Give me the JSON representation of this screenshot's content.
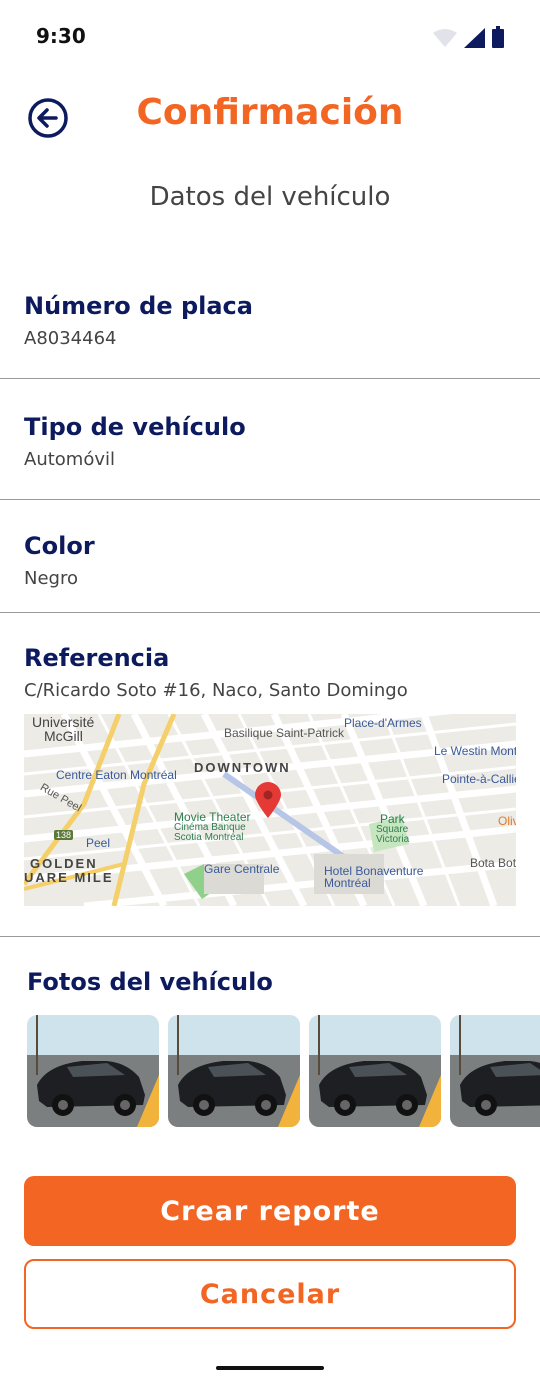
{
  "status": {
    "time": "9:30"
  },
  "header": {
    "title": "Confirmación",
    "back_icon": "arrow-left-circle-icon"
  },
  "subtitle": "Datos del vehículo",
  "fields": [
    {
      "label": "Número de placa",
      "value": "A8034464"
    },
    {
      "label": "Tipo de vehículo",
      "value": "Automóvil"
    },
    {
      "label": "Color",
      "value": "Negro"
    },
    {
      "label": "Referencia",
      "value": "C/Ricardo Soto #16, Naco, Santo Domingo"
    }
  ],
  "map": {
    "labels": {
      "universite": "Université",
      "mcgill": "McGill",
      "basilique": "Basilique Saint-Patrick",
      "place_darmes": "Place-d'Armes",
      "centre_eaton": "Centre Eaton Montréal",
      "downtown": "DOWNTOWN",
      "westin": "Le Westin Mont",
      "pointe": "Pointe-à-Calliè",
      "movie1": "Movie Theater",
      "movie2": "Cinéma Banque",
      "movie3": "Scotia Montréal",
      "park1": "Park",
      "park2": "Square",
      "park3": "Victoria",
      "peel": "Peel",
      "golden": "GOLDEN",
      "square_mile": "UARE MILE",
      "gare": "Gare Centrale",
      "hotel1": "Hotel Bonaventure",
      "hotel2": "Montréal",
      "bota": "Bota Bota",
      "olive": "Oliv",
      "rue_peel": "Rue Peel",
      "route": "138"
    },
    "pin_icon": "map-pin-icon"
  },
  "photos": {
    "title": "Fotos del vehículo",
    "items": [
      "car-photo",
      "car-photo",
      "car-photo",
      "car-photo"
    ]
  },
  "actions": {
    "primary": "Crear reporte",
    "secondary": "Cancelar"
  },
  "colors": {
    "accent": "#f26522",
    "navy": "#0d1b5e"
  }
}
